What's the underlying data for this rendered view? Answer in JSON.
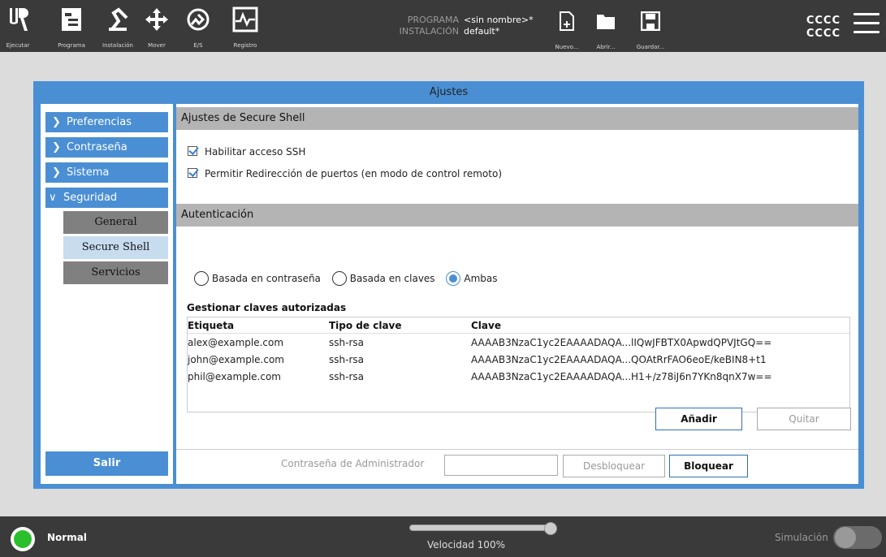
{
  "topbar": {
    "nav": [
      {
        "label": "Ejecutar",
        "icon": "ur-logo-icon"
      },
      {
        "label": "Programa",
        "icon": "program-icon"
      },
      {
        "label": "Instalación",
        "icon": "installation-icon"
      },
      {
        "label": "Mover",
        "icon": "move-icon"
      },
      {
        "label": "E/S",
        "icon": "io-icon"
      },
      {
        "label": "Registro",
        "icon": "log-icon"
      }
    ],
    "program_label": "PROGRAMA",
    "program_value": "<sin nombre>*",
    "installation_label": "INSTALACIÓN",
    "installation_value": "default*",
    "file_buttons": [
      {
        "label": "Nuevo...",
        "icon": "new-file-icon"
      },
      {
        "label": "Abrir...",
        "icon": "folder-icon"
      },
      {
        "label": "Guardar...",
        "icon": "save-icon"
      }
    ],
    "user_line1": "CCCC",
    "user_line2": "CCCC"
  },
  "dialog": {
    "title": "Ajustes",
    "sidebar": {
      "items": [
        {
          "label": "Preferencias",
          "expanded": false
        },
        {
          "label": "Contraseña",
          "expanded": false
        },
        {
          "label": "Sistema",
          "expanded": false
        },
        {
          "label": "Seguridad",
          "expanded": true
        }
      ],
      "subitems": [
        {
          "label": "General",
          "active": false
        },
        {
          "label": "Secure Shell",
          "active": true
        },
        {
          "label": "Servicios",
          "active": false
        }
      ],
      "exit_label": "Salir"
    },
    "ssh": {
      "header": "Ajustes de Secure Shell",
      "enable_ssh": {
        "label": "Habilitar acceso SSH",
        "checked": true
      },
      "port_forward": {
        "label": "Permitir Redirección de puertos (en modo de control remoto)",
        "checked": true
      }
    },
    "auth": {
      "header": "Autenticación",
      "options": [
        {
          "label": "Basada en contraseña",
          "selected": false
        },
        {
          "label": "Basada en claves",
          "selected": false
        },
        {
          "label": "Ambas",
          "selected": true
        }
      ],
      "keys_title": "Gestionar claves autorizadas",
      "columns": [
        "Etiqueta",
        "Tipo de clave",
        "Clave"
      ],
      "rows": [
        [
          "alex@example.com",
          "ssh-rsa",
          "AAAAB3NzaC1yc2EAAAADAQA...lIQwJFBTX0ApwdQPVJtGQ=="
        ],
        [
          "john@example.com",
          "ssh-rsa",
          "AAAAB3NzaC1yc2EAAAADAQA...QOAtRrFAO6eoE/keBIN8+t1"
        ],
        [
          "phil@example.com",
          "ssh-rsa",
          "AAAAB3NzaC1yc2EAAAADAQA...H1+/z78iJ6n7YKn8qnX7w=="
        ]
      ],
      "add_label": "Añadir",
      "remove_label": "Quitar"
    },
    "admin": {
      "password_label": "Contraseña de Administrador",
      "unlock_label": "Desbloquear",
      "lock_label": "Bloquear"
    }
  },
  "footer": {
    "status": "Normal",
    "speed_label": "Velocidad 100%",
    "speed_fraction": 1.0,
    "simulation_label": "Simulación",
    "simulation_on": false
  },
  "colors": {
    "accent": "#4a8fd3",
    "topbar": "#3a3a3a",
    "status_ok": "#2cbf2c"
  }
}
